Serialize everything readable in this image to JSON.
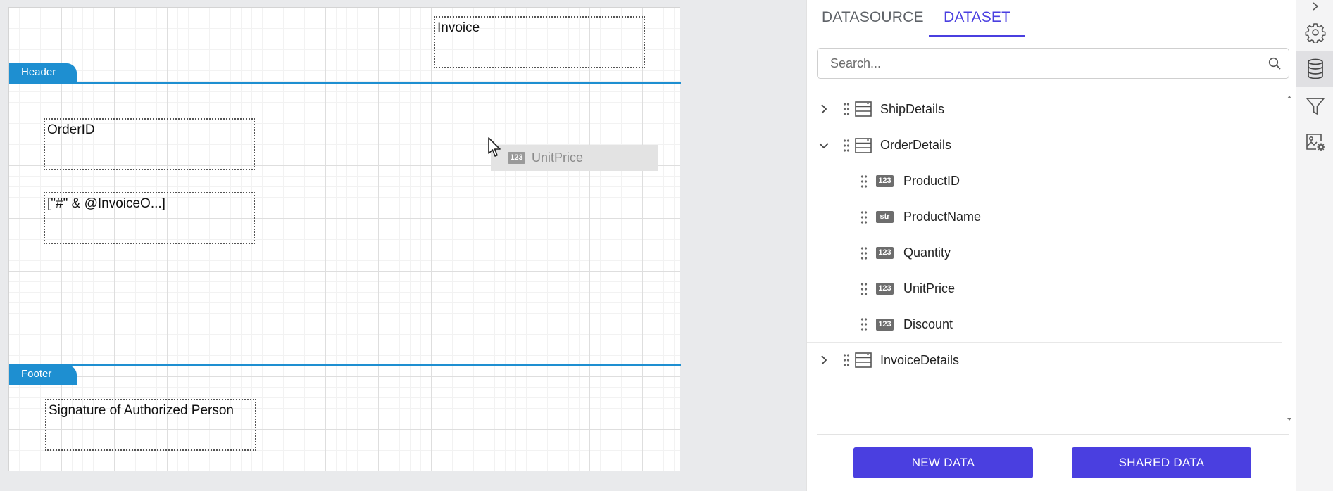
{
  "designer": {
    "bands": {
      "header_label": "Header",
      "footer_label": "Footer"
    },
    "items": {
      "invoice_title": "Invoice",
      "order_id": "OrderID",
      "invoice_expr": "[\"#\" & @InvoiceO...]",
      "signature": "Signature of Authorized Person"
    },
    "drag_ghost": {
      "type_badge": "123",
      "label": "UnitPrice"
    }
  },
  "panel": {
    "tabs": [
      {
        "label": "DATASOURCE",
        "active": false
      },
      {
        "label": "DATASET",
        "active": true
      }
    ],
    "search": {
      "placeholder": "Search...",
      "value": ""
    },
    "datasets": [
      {
        "name": "ShipDetails",
        "expanded": false,
        "fields": []
      },
      {
        "name": "OrderDetails",
        "expanded": true,
        "fields": [
          {
            "type": "123",
            "name": "ProductID"
          },
          {
            "type": "str",
            "name": "ProductName"
          },
          {
            "type": "123",
            "name": "Quantity"
          },
          {
            "type": "123",
            "name": "UnitPrice"
          },
          {
            "type": "123",
            "name": "Discount"
          }
        ]
      },
      {
        "name": "InvoiceDetails",
        "expanded": false,
        "fields": []
      }
    ],
    "buttons": {
      "new_data": "NEW DATA",
      "shared_data": "SHARED DATA"
    }
  },
  "side_strip": {
    "icons": [
      "chevron-right-icon",
      "gear-icon",
      "database-icon",
      "filter-icon",
      "image-settings-icon"
    ],
    "active": "database-icon"
  },
  "colors": {
    "accent": "#4a3fe0",
    "band": "#1e8fd1",
    "type_badge": "#6d6d6d"
  }
}
